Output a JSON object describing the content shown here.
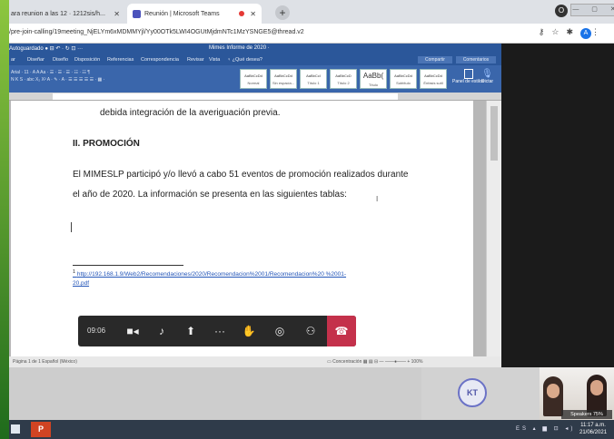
{
  "browser": {
    "tabs": [
      {
        "label": "ara reunion a las 12 · 1212sis/h...",
        "close": "✕"
      },
      {
        "label": "Reunión | Microsoft Teams",
        "close": "✕"
      }
    ],
    "new_tab": "+",
    "url": "/pre-join-calling/19meeting_NjELYm6xMDMMYjl/Yy00OTk5LWI4OGUtMjdmNTc1MzYSNGE5@thread.v2",
    "window_controls": "— ▢ ✕",
    "profile_initial": "A",
    "chrome_icon": "O"
  },
  "word": {
    "title_left": "Autoguardado ● ⊟ ↶ · ↻ ⊡ ···",
    "title_center": "Mimes Informe de 2020 ·",
    "menu": [
      "ar",
      "Diseñar",
      "Diseño",
      "Disposición",
      "Referencias",
      "Correspondencia",
      "Revisar",
      "Vista",
      "♀ ¿Qué desea?"
    ],
    "share": "Compartir",
    "comments": "Comentarios",
    "ribbon_line1": "Arial · 11 · A A Aa ·  ☰ · ☰ · ☰ · ☷ · ☷ ¶",
    "ribbon_line2": "N K S · abc X₂ X² A · ✎ · A ·  ☰ ☰ ☰ ☰ ☰ · ▦ ·",
    "styles": [
      {
        "sample": "AaBbCcDd",
        "name": "Normal"
      },
      {
        "sample": "AaBbCcDd",
        "name": "Sin espacia..."
      },
      {
        "sample": "AaBbCcI",
        "name": "Título 1"
      },
      {
        "sample": "AaBbCcD",
        "name": "Título 2"
      },
      {
        "sample": "AaBb(",
        "name": "Título"
      },
      {
        "sample": "AaBbCcDd",
        "name": "Subtítulo"
      },
      {
        "sample": "AaBbCcDd",
        "name": "Énfasis sutil"
      }
    ],
    "styles_pane": "Panel de estilos",
    "dictate": "Dictar",
    "doc": {
      "line1": "debida integración de la averiguación previa.",
      "heading": "II. PROMOCIÓN",
      "para_line1": "El MIMESLP participó y/o llevó a cabo 51 eventos de promoción realizados durante",
      "para_line2": "el año de 2020. La información se presenta en las siguientes tablas:",
      "footnote_mark": "1",
      "footnote_line1": "http://192.168.1.9/Web2/Recomendaciones/2020/Recomendacion%2001/Recomendacion%20 %2001-",
      "footnote_line2": "20.pdf"
    },
    "status_left": "Página 1 de 1   Español (México)",
    "status_right": "▭ Concentración   ▦ ▤ ⊟  — ——●—— +  100%"
  },
  "meeting": {
    "timer": "09:06",
    "buttons": [
      "camera",
      "mic",
      "share",
      "more",
      "raise-hand",
      "chat",
      "participants",
      "hang-up"
    ]
  },
  "participants": {
    "avatar_initials": "KT",
    "speaker_label": "Speakers 75%"
  },
  "taskbar": {
    "app": "P",
    "tray": "ES ▴ ▆ ⊡ ◂)",
    "time": "11:17 a.m.",
    "date": "21/06/2021"
  }
}
